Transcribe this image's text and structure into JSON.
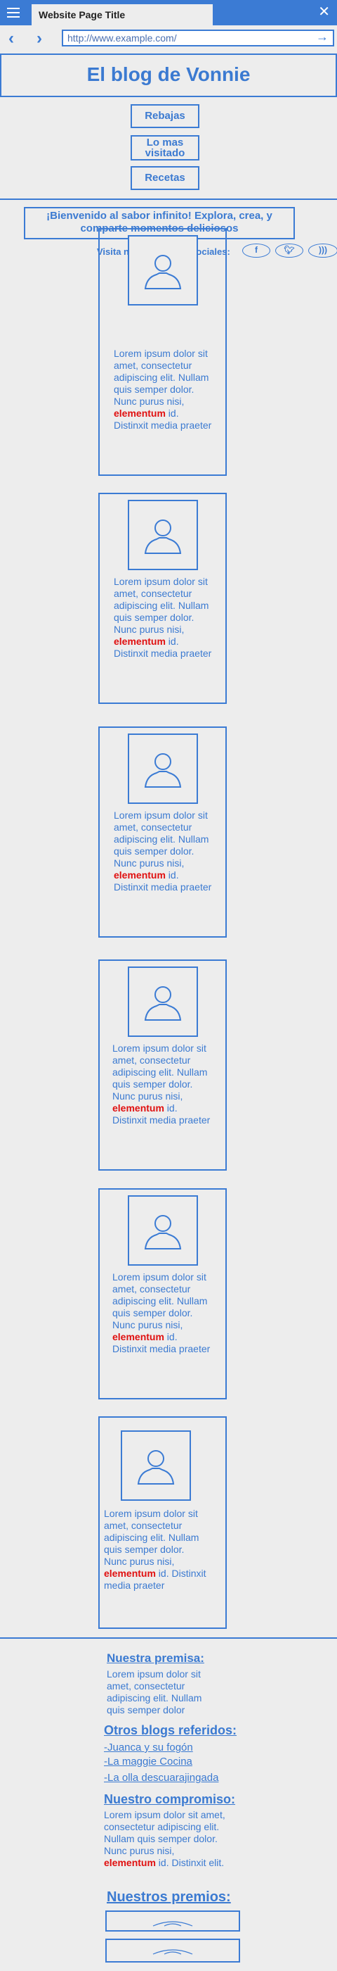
{
  "browser": {
    "tab_title": "Website Page Title",
    "url": "http://www.example.com/"
  },
  "header": {
    "title": "El blog de Vonnie"
  },
  "menu": [
    {
      "label": "Rebajas"
    },
    {
      "label": "Lo mas visitado"
    },
    {
      "label": "Recetas"
    }
  ],
  "welcome": "¡Bienvenido al sabor infinito!  Explora, crea, y comparte momentos deliciosos",
  "social": {
    "label": "Visita nuestras redes sociales:",
    "icons": [
      "facebook-icon",
      "twitter-icon",
      "rss-icon"
    ]
  },
  "posts": [
    {
      "text_before": "Lorem ipsum dolor sit amet, consectetur adipiscing elit. Nullam quis semper dolor. Nunc purus nisi, ",
      "highlight": "elementum",
      "text_after": " id. Distinxit  media praeter"
    },
    {
      "text_before": "Lorem ipsum dolor sit amet, consectetur adipiscing elit. Nullam quis semper dolor. Nunc purus nisi, ",
      "highlight": "elementum",
      "text_after": " id. Distinxit  media praeter"
    },
    {
      "text_before": "Lorem ipsum dolor sit amet, consectetur adipiscing elit. Nullam quis semper dolor. Nunc purus nisi, ",
      "highlight": "elementum",
      "text_after": " id. Distinxit  media praeter"
    },
    {
      "text_before": "Lorem ipsum dolor sit amet, consectetur adipiscing elit. Nullam quis semper dolor. Nunc purus nisi, ",
      "highlight": "elementum",
      "text_after": " id. Distinxit  media praeter"
    },
    {
      "text_before": "Lorem ipsum dolor sit amet, consectetur adipiscing elit. Nullam quis semper dolor. Nunc purus nisi, ",
      "highlight": "elementum",
      "text_after": " id. Distinxit  media praeter"
    },
    {
      "text_before": "Lorem ipsum dolor sit amet, consectetur adipiscing elit. Nullam quis semper dolor. Nunc purus nisi, ",
      "highlight": "elementum",
      "text_after": " id. Distinxit  media praeter"
    }
  ],
  "footer": {
    "premise_title": "Nuestra premisa:",
    "premise_text": "Lorem ipsum dolor sit amet, consectetur adipiscing elit. Nullam quis semper dolor",
    "blogs_title": "Otros blogs referidos:",
    "blogs": [
      "-Juanca y su fogón",
      "-La maggie Cocina",
      "-La olla descuarajingada"
    ],
    "commitment_title": "Nuestro compromiso:",
    "commitment_before": "Lorem ipsum dolor sit amet, consectetur adipiscing elit. Nullam quis semper dolor. Nunc purus nisi, ",
    "commitment_highlight": "elementum",
    "commitment_after": " id. Distinxit   elit.",
    "awards_title": "Nuestros premios:"
  }
}
